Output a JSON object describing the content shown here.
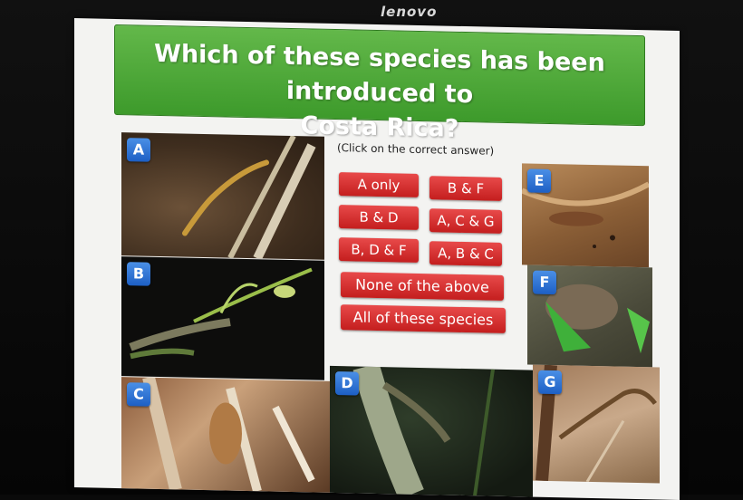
{
  "monitor": {
    "brand": "lenovo"
  },
  "quiz": {
    "question_line1": "Which of these species has been introduced to",
    "question_line2": "Costa Rica?",
    "hint": "(Click on the correct answer)",
    "answers": [
      "A only",
      "B & F",
      "B & D",
      "A, C & G",
      "B, D & F",
      "A, B & C",
      "None of the above",
      "All of these species"
    ],
    "photos": [
      "A",
      "B",
      "C",
      "D",
      "E",
      "F",
      "G"
    ]
  },
  "colors": {
    "banner": "#4aa832",
    "answer": "#d42a2a",
    "tag": "#2a6fd6"
  }
}
